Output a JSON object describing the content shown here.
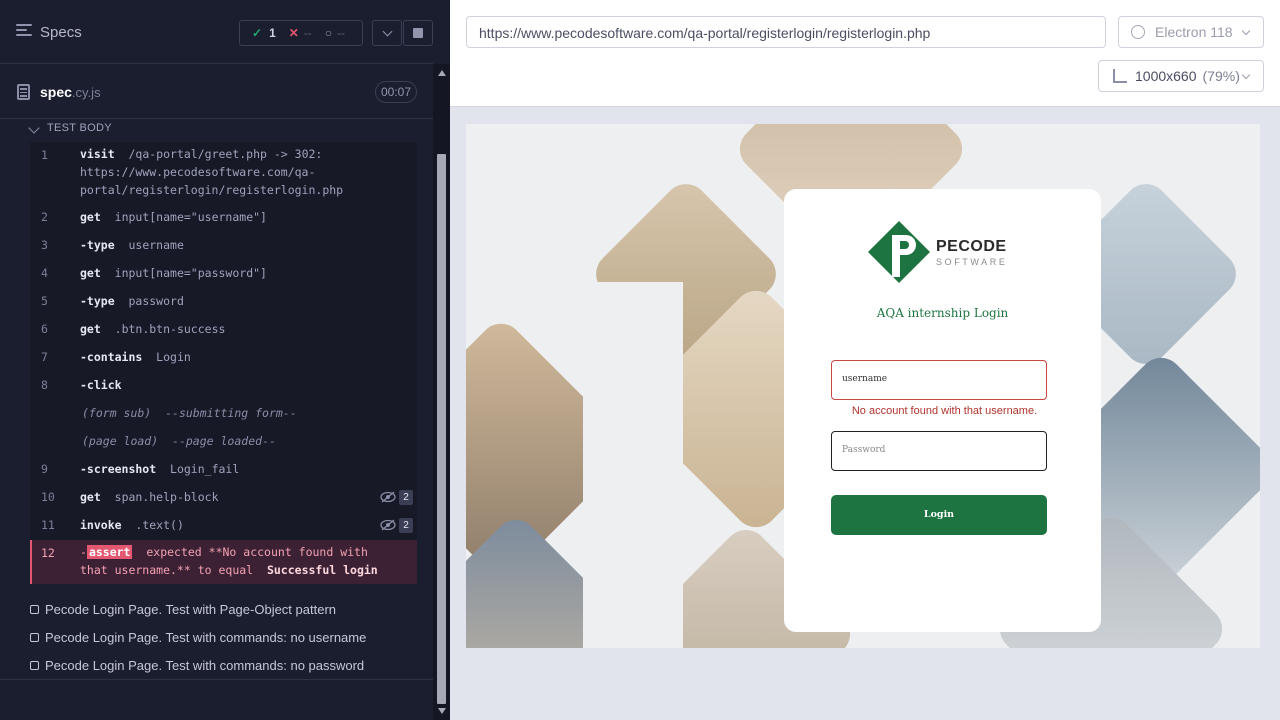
{
  "reporter": {
    "specs_title": "Specs",
    "stats": {
      "passed_count": "1",
      "failed_count": "--",
      "pending_count": "--"
    },
    "spec": {
      "name": "spec",
      "ext": ".cy.js",
      "duration": "00:07"
    },
    "test_body_label": "TEST BODY",
    "commands": [
      {
        "num": "1",
        "name": "visit",
        "arg": "/qa-portal/greet.php -> 302: https://www.pecodesoftware.com/qa-portal/registerlogin/registerlogin.php"
      },
      {
        "num": "2",
        "name": "get",
        "arg": "input[name=\"username\"]"
      },
      {
        "num": "3",
        "name": "-type",
        "arg": "username"
      },
      {
        "num": "4",
        "name": "get",
        "arg": "input[name=\"password\"]"
      },
      {
        "num": "5",
        "name": "-type",
        "arg": "password"
      },
      {
        "num": "6",
        "name": "get",
        "arg": ".btn.btn-success"
      },
      {
        "num": "7",
        "name": "-contains",
        "arg": "Login"
      },
      {
        "num": "8",
        "name": "-click",
        "arg": ""
      },
      {
        "num": "",
        "name": "(form sub)",
        "arg": "--submitting form--"
      },
      {
        "num": "",
        "name": "(page load)",
        "arg": "--page loaded--"
      },
      {
        "num": "9",
        "name": "-screenshot",
        "arg": "Login_fail"
      },
      {
        "num": "10",
        "name": "get",
        "arg": "span.help-block",
        "hidden_count": "2"
      },
      {
        "num": "11",
        "name": "invoke",
        "arg": ".text()",
        "hidden_count": "2"
      }
    ],
    "error_command": {
      "num": "12",
      "dash": "-",
      "tag": "assert",
      "message": "expected **No account found with that username.** to equal",
      "value": "Successful login"
    },
    "other_tests": [
      "Pecode Login Page. Test with Page-Object pattern",
      "Pecode Login Page. Test with commands: no username",
      "Pecode Login Page. Test with commands: no password"
    ]
  },
  "toolbar": {
    "url": "https://www.pecodesoftware.com/qa-portal/registerlogin/registerlogin.php",
    "browser": "Electron 118",
    "viewport": "1000x660",
    "scale": "(79%)"
  },
  "aut": {
    "brand_name": "PECODE",
    "brand_sub": "SOFTWARE",
    "form_title": "AQA internship Login",
    "username_value": "username",
    "help_text": "No account found with that username.",
    "password_placeholder": "Password",
    "login_label": "Login",
    "brand_color": "#1d7440",
    "error_color": "#b0332d"
  }
}
